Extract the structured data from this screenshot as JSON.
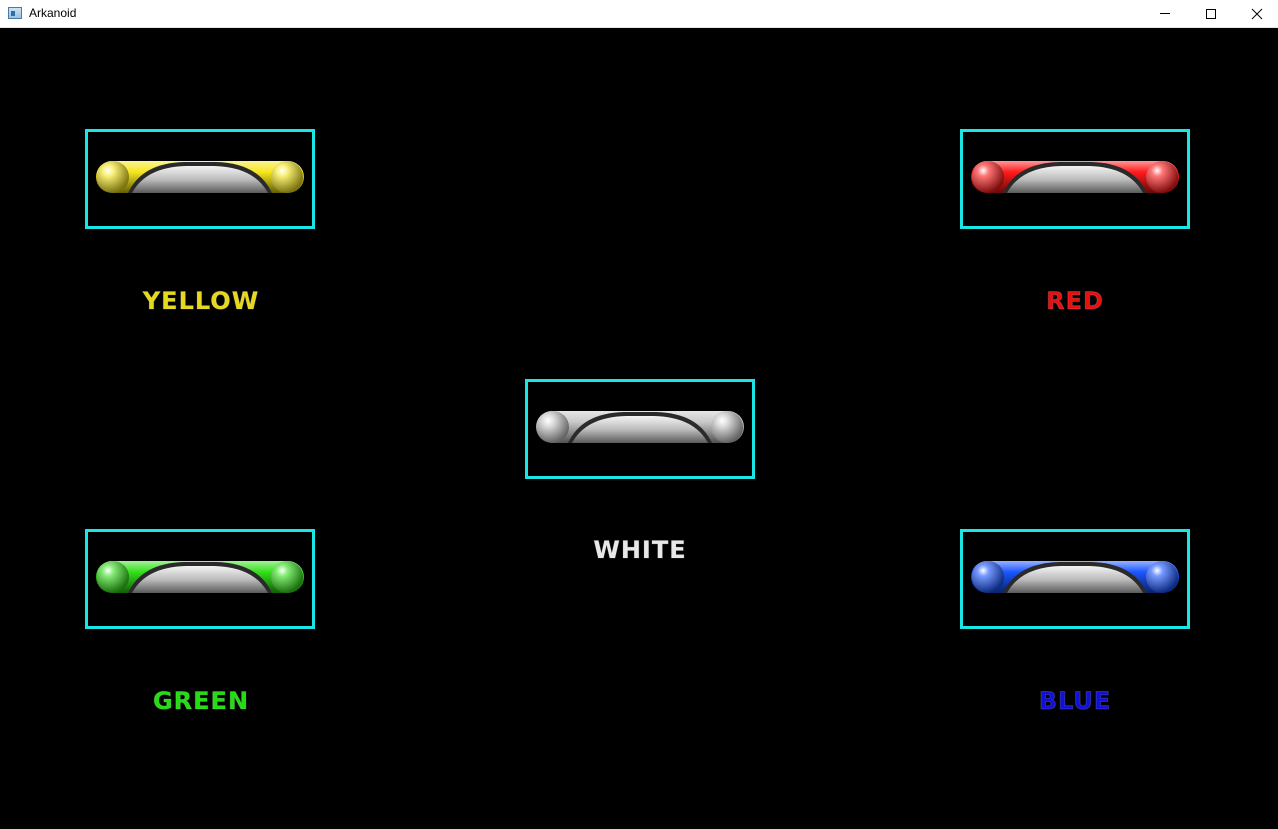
{
  "window": {
    "title": "Arkanoid"
  },
  "paddles": {
    "yellow": {
      "label": "YELLOW",
      "color": "#f5e61c",
      "label_color": "#e6d81a"
    },
    "red": {
      "label": "RED",
      "color": "#ff1a1a",
      "label_color": "#e61010"
    },
    "white": {
      "label": "WHITE",
      "color": "#c8c8c8",
      "label_color": "#e8e8e8"
    },
    "green": {
      "label": "GREEN",
      "color": "#33e01a",
      "label_color": "#22dd11"
    },
    "blue": {
      "label": "BLUE",
      "color": "#1a55ff",
      "label_color": "#1010d8"
    }
  },
  "icons": {
    "app": "app-icon",
    "minimize": "minimize-icon",
    "maximize": "maximize-icon",
    "close": "close-icon"
  },
  "colors": {
    "background": "#000000",
    "selection_border": "#1ae6e6"
  }
}
